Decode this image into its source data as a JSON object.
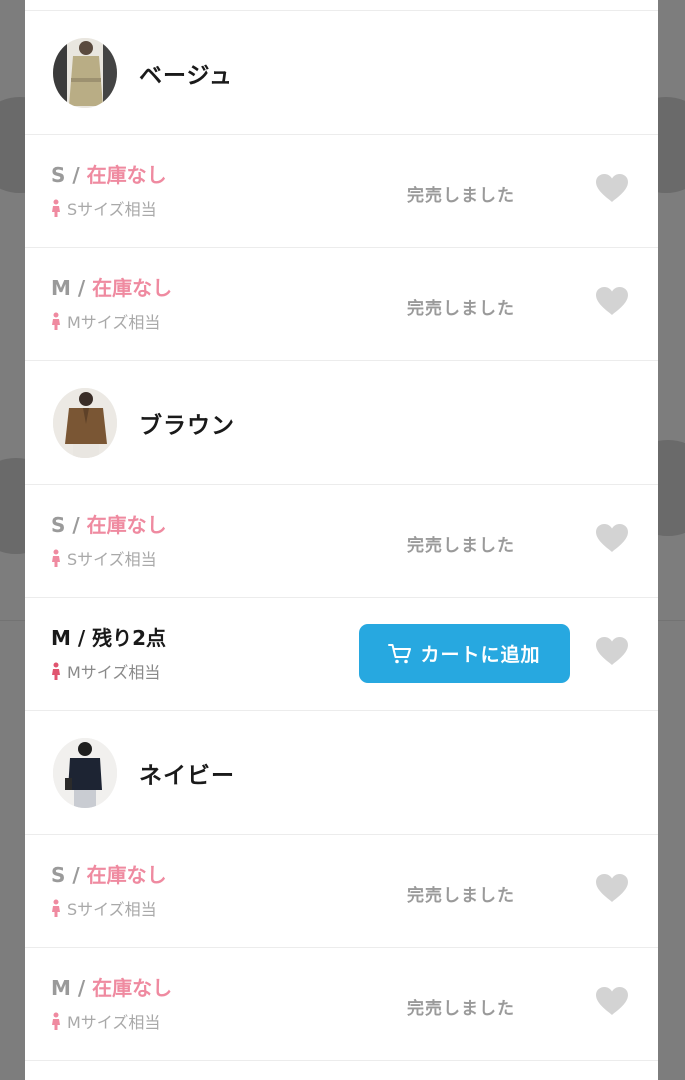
{
  "colors": {
    "accent_blue": "#27a8e0",
    "stock_out_pink": "#ef8aa0",
    "muted_gray": "#9a9a9a",
    "heart_gray": "#d3d3d3"
  },
  "variants": [
    {
      "color_name": "ベージュ",
      "sizes": [
        {
          "size": "S",
          "separator": " / ",
          "stock": "在庫なし",
          "fit": "Sサイズ相当",
          "status": "完売しました"
        },
        {
          "size": "M",
          "separator": " / ",
          "stock": "在庫なし",
          "fit": "Mサイズ相当",
          "status": "完売しました"
        }
      ]
    },
    {
      "color_name": "ブラウン",
      "sizes": [
        {
          "size": "S",
          "separator": " / ",
          "stock": "在庫なし",
          "fit": "Sサイズ相当",
          "status": "完売しました"
        },
        {
          "size": "M",
          "separator": " / ",
          "stock": "残り2点",
          "fit": "Mサイズ相当",
          "button": "カートに追加"
        }
      ]
    },
    {
      "color_name": "ネイビー",
      "sizes": [
        {
          "size": "S",
          "separator": " / ",
          "stock": "在庫なし",
          "fit": "Sサイズ相当",
          "status": "完売しました"
        },
        {
          "size": "M",
          "separator": " / ",
          "stock": "在庫なし",
          "fit": "Mサイズ相当",
          "status": "完売しました"
        }
      ]
    }
  ]
}
